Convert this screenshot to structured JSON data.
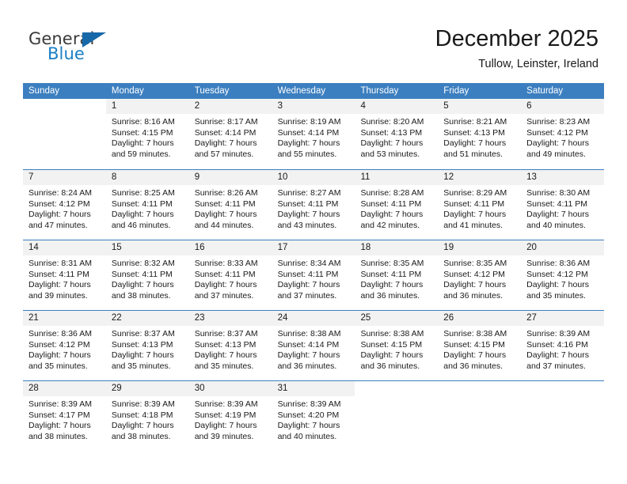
{
  "brand": {
    "name_part1": "General",
    "name_part2": "Blue",
    "triangle_color": "#1668a8",
    "blue_color": "#1b7fc4"
  },
  "header": {
    "title": "December 2025",
    "location": "Tullow, Leinster, Ireland"
  },
  "theme": {
    "header_row_bg": "#3c7fc0",
    "day_number_bg": "#f2f2f2",
    "page_bg": "#ffffff",
    "text_color": "#1a1a1a"
  },
  "weekdays": [
    "Sunday",
    "Monday",
    "Tuesday",
    "Wednesday",
    "Thursday",
    "Friday",
    "Saturday"
  ],
  "labels": {
    "sunrise_prefix": "Sunrise:",
    "sunset_prefix": "Sunset:",
    "daylight_prefix": "Daylight:"
  },
  "weeks": [
    [
      {
        "day": "",
        "empty": true
      },
      {
        "day": "1",
        "sunrise": "Sunrise: 8:16 AM",
        "sunset": "Sunset: 4:15 PM",
        "daylight_line1": "Daylight: 7 hours",
        "daylight_line2": "and 59 minutes."
      },
      {
        "day": "2",
        "sunrise": "Sunrise: 8:17 AM",
        "sunset": "Sunset: 4:14 PM",
        "daylight_line1": "Daylight: 7 hours",
        "daylight_line2": "and 57 minutes."
      },
      {
        "day": "3",
        "sunrise": "Sunrise: 8:19 AM",
        "sunset": "Sunset: 4:14 PM",
        "daylight_line1": "Daylight: 7 hours",
        "daylight_line2": "and 55 minutes."
      },
      {
        "day": "4",
        "sunrise": "Sunrise: 8:20 AM",
        "sunset": "Sunset: 4:13 PM",
        "daylight_line1": "Daylight: 7 hours",
        "daylight_line2": "and 53 minutes."
      },
      {
        "day": "5",
        "sunrise": "Sunrise: 8:21 AM",
        "sunset": "Sunset: 4:13 PM",
        "daylight_line1": "Daylight: 7 hours",
        "daylight_line2": "and 51 minutes."
      },
      {
        "day": "6",
        "sunrise": "Sunrise: 8:23 AM",
        "sunset": "Sunset: 4:12 PM",
        "daylight_line1": "Daylight: 7 hours",
        "daylight_line2": "and 49 minutes."
      }
    ],
    [
      {
        "day": "7",
        "sunrise": "Sunrise: 8:24 AM",
        "sunset": "Sunset: 4:12 PM",
        "daylight_line1": "Daylight: 7 hours",
        "daylight_line2": "and 47 minutes."
      },
      {
        "day": "8",
        "sunrise": "Sunrise: 8:25 AM",
        "sunset": "Sunset: 4:11 PM",
        "daylight_line1": "Daylight: 7 hours",
        "daylight_line2": "and 46 minutes."
      },
      {
        "day": "9",
        "sunrise": "Sunrise: 8:26 AM",
        "sunset": "Sunset: 4:11 PM",
        "daylight_line1": "Daylight: 7 hours",
        "daylight_line2": "and 44 minutes."
      },
      {
        "day": "10",
        "sunrise": "Sunrise: 8:27 AM",
        "sunset": "Sunset: 4:11 PM",
        "daylight_line1": "Daylight: 7 hours",
        "daylight_line2": "and 43 minutes."
      },
      {
        "day": "11",
        "sunrise": "Sunrise: 8:28 AM",
        "sunset": "Sunset: 4:11 PM",
        "daylight_line1": "Daylight: 7 hours",
        "daylight_line2": "and 42 minutes."
      },
      {
        "day": "12",
        "sunrise": "Sunrise: 8:29 AM",
        "sunset": "Sunset: 4:11 PM",
        "daylight_line1": "Daylight: 7 hours",
        "daylight_line2": "and 41 minutes."
      },
      {
        "day": "13",
        "sunrise": "Sunrise: 8:30 AM",
        "sunset": "Sunset: 4:11 PM",
        "daylight_line1": "Daylight: 7 hours",
        "daylight_line2": "and 40 minutes."
      }
    ],
    [
      {
        "day": "14",
        "sunrise": "Sunrise: 8:31 AM",
        "sunset": "Sunset: 4:11 PM",
        "daylight_line1": "Daylight: 7 hours",
        "daylight_line2": "and 39 minutes."
      },
      {
        "day": "15",
        "sunrise": "Sunrise: 8:32 AM",
        "sunset": "Sunset: 4:11 PM",
        "daylight_line1": "Daylight: 7 hours",
        "daylight_line2": "and 38 minutes."
      },
      {
        "day": "16",
        "sunrise": "Sunrise: 8:33 AM",
        "sunset": "Sunset: 4:11 PM",
        "daylight_line1": "Daylight: 7 hours",
        "daylight_line2": "and 37 minutes."
      },
      {
        "day": "17",
        "sunrise": "Sunrise: 8:34 AM",
        "sunset": "Sunset: 4:11 PM",
        "daylight_line1": "Daylight: 7 hours",
        "daylight_line2": "and 37 minutes."
      },
      {
        "day": "18",
        "sunrise": "Sunrise: 8:35 AM",
        "sunset": "Sunset: 4:11 PM",
        "daylight_line1": "Daylight: 7 hours",
        "daylight_line2": "and 36 minutes."
      },
      {
        "day": "19",
        "sunrise": "Sunrise: 8:35 AM",
        "sunset": "Sunset: 4:12 PM",
        "daylight_line1": "Daylight: 7 hours",
        "daylight_line2": "and 36 minutes."
      },
      {
        "day": "20",
        "sunrise": "Sunrise: 8:36 AM",
        "sunset": "Sunset: 4:12 PM",
        "daylight_line1": "Daylight: 7 hours",
        "daylight_line2": "and 35 minutes."
      }
    ],
    [
      {
        "day": "21",
        "sunrise": "Sunrise: 8:36 AM",
        "sunset": "Sunset: 4:12 PM",
        "daylight_line1": "Daylight: 7 hours",
        "daylight_line2": "and 35 minutes."
      },
      {
        "day": "22",
        "sunrise": "Sunrise: 8:37 AM",
        "sunset": "Sunset: 4:13 PM",
        "daylight_line1": "Daylight: 7 hours",
        "daylight_line2": "and 35 minutes."
      },
      {
        "day": "23",
        "sunrise": "Sunrise: 8:37 AM",
        "sunset": "Sunset: 4:13 PM",
        "daylight_line1": "Daylight: 7 hours",
        "daylight_line2": "and 35 minutes."
      },
      {
        "day": "24",
        "sunrise": "Sunrise: 8:38 AM",
        "sunset": "Sunset: 4:14 PM",
        "daylight_line1": "Daylight: 7 hours",
        "daylight_line2": "and 36 minutes."
      },
      {
        "day": "25",
        "sunrise": "Sunrise: 8:38 AM",
        "sunset": "Sunset: 4:15 PM",
        "daylight_line1": "Daylight: 7 hours",
        "daylight_line2": "and 36 minutes."
      },
      {
        "day": "26",
        "sunrise": "Sunrise: 8:38 AM",
        "sunset": "Sunset: 4:15 PM",
        "daylight_line1": "Daylight: 7 hours",
        "daylight_line2": "and 36 minutes."
      },
      {
        "day": "27",
        "sunrise": "Sunrise: 8:39 AM",
        "sunset": "Sunset: 4:16 PM",
        "daylight_line1": "Daylight: 7 hours",
        "daylight_line2": "and 37 minutes."
      }
    ],
    [
      {
        "day": "28",
        "sunrise": "Sunrise: 8:39 AM",
        "sunset": "Sunset: 4:17 PM",
        "daylight_line1": "Daylight: 7 hours",
        "daylight_line2": "and 38 minutes."
      },
      {
        "day": "29",
        "sunrise": "Sunrise: 8:39 AM",
        "sunset": "Sunset: 4:18 PM",
        "daylight_line1": "Daylight: 7 hours",
        "daylight_line2": "and 38 minutes."
      },
      {
        "day": "30",
        "sunrise": "Sunrise: 8:39 AM",
        "sunset": "Sunset: 4:19 PM",
        "daylight_line1": "Daylight: 7 hours",
        "daylight_line2": "and 39 minutes."
      },
      {
        "day": "31",
        "sunrise": "Sunrise: 8:39 AM",
        "sunset": "Sunset: 4:20 PM",
        "daylight_line1": "Daylight: 7 hours",
        "daylight_line2": "and 40 minutes."
      },
      {
        "day": "",
        "empty": true
      },
      {
        "day": "",
        "empty": true
      },
      {
        "day": "",
        "empty": true
      }
    ]
  ]
}
